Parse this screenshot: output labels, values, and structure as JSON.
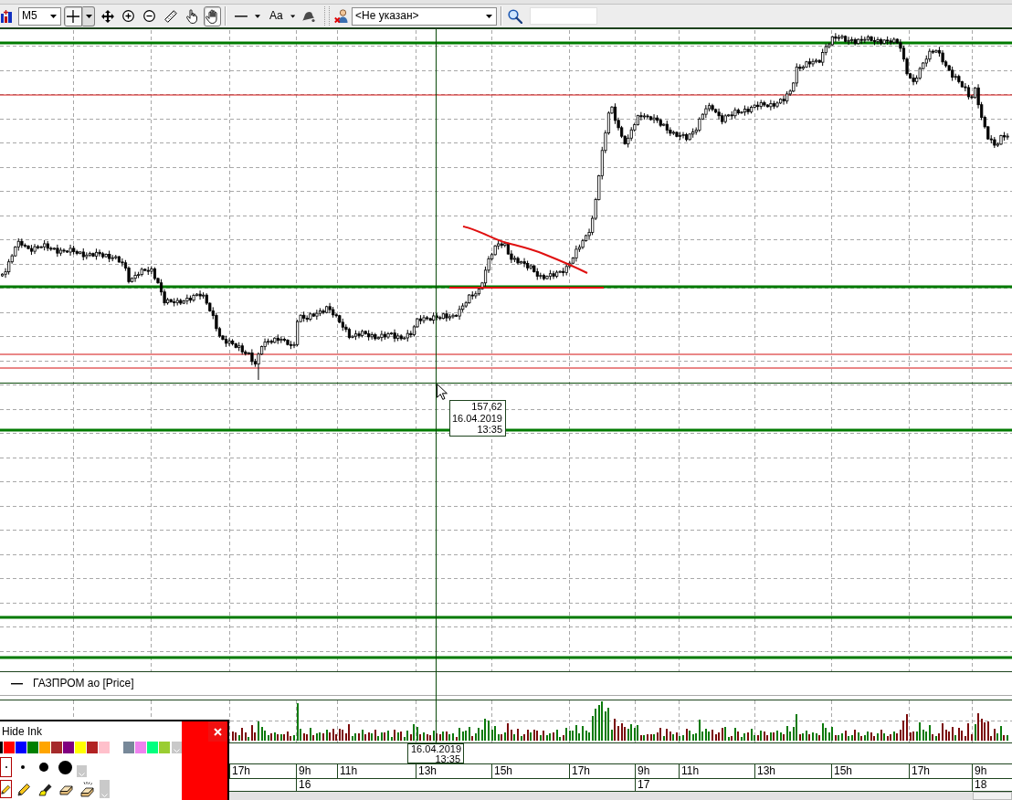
{
  "toolbar": {
    "interval": "M5",
    "tools": [
      {
        "kind": "crosshair",
        "selected": true
      },
      {
        "kind": "move",
        "selected": false
      },
      {
        "kind": "zoom-in",
        "selected": false
      },
      {
        "kind": "zoom-out",
        "selected": false
      },
      {
        "kind": "ruler",
        "selected": false
      },
      {
        "kind": "finger",
        "selected": false
      },
      {
        "kind": "hand",
        "selected": true
      }
    ],
    "font_button": "Aa",
    "client": "<Не указан>"
  },
  "chart": {
    "tooltip": {
      "price": "157,62",
      "date": "16.04.2019",
      "time": "13:35"
    },
    "legend": "ГАЗПРОМ ао [Price]",
    "cursor_label": {
      "date": "16.04.2019",
      "time": "13:35"
    },
    "hours": [
      "17h",
      "9h",
      "11h",
      "13h",
      "15h",
      "17h",
      "9h",
      "11h",
      "13h",
      "15h",
      "17h",
      "9h"
    ],
    "days": [
      "16",
      "17",
      "18"
    ]
  },
  "ink_panel": {
    "title": "Hide Ink",
    "colors": [
      {
        "color": "#000000"
      },
      {
        "color": "#ff0000"
      },
      {
        "color": "#0000ff"
      },
      {
        "color": "#008000"
      },
      {
        "color": "#ffa500"
      },
      {
        "color": "#a52a2a"
      },
      {
        "color": "#800080"
      },
      {
        "color": "#ffff00"
      },
      {
        "color": "#b22222"
      },
      {
        "color": "#ffc0cb"
      },
      {
        "color": "#778899"
      },
      {
        "color": "#ee82ee"
      },
      {
        "color": "#00ff7f"
      },
      {
        "color": "#9acd32"
      }
    ],
    "pen_sizes": [
      {
        "selected": true
      },
      {
        "selected": false
      },
      {
        "selected": false
      },
      {
        "selected": false
      }
    ],
    "tools": [
      {
        "kind": "pencil",
        "selected": true
      },
      {
        "kind": "pencil",
        "selected": false
      },
      {
        "kind": "highlighter",
        "selected": false
      },
      {
        "kind": "eraser",
        "selected": false
      },
      {
        "kind": "sweeper",
        "selected": false
      }
    ]
  }
}
